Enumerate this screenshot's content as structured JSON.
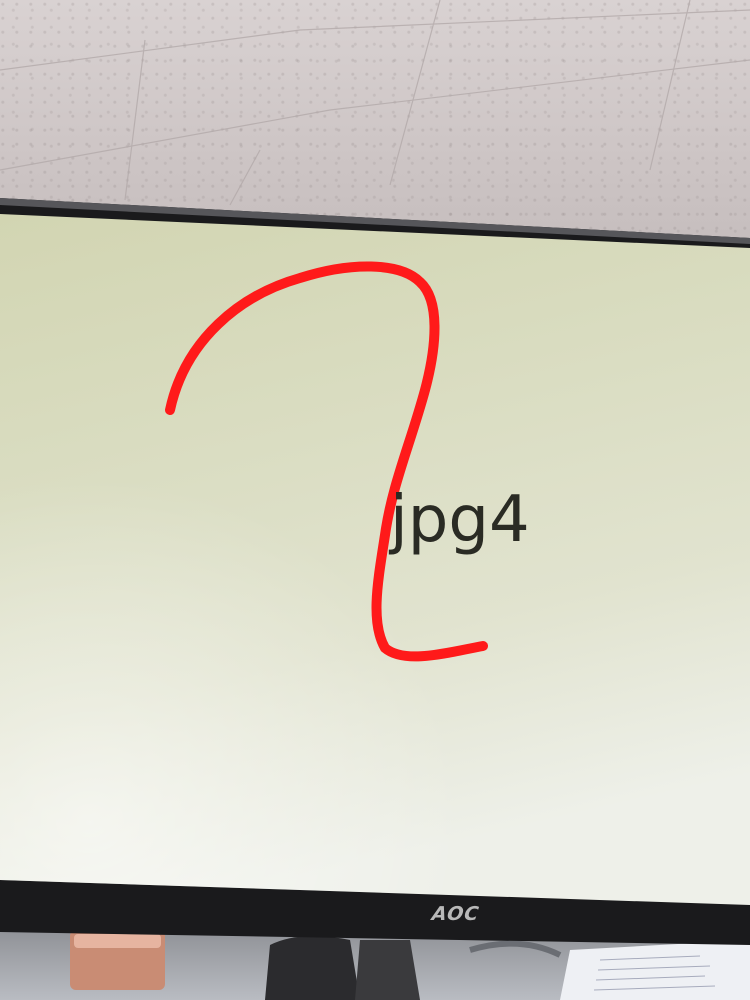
{
  "screen": {
    "text": "jpg4",
    "background_color": "#d9dcc0",
    "text_color": "#2a2b24"
  },
  "annotation": {
    "stroke_color": "#ff1a1a",
    "icon": "red-freehand-curve"
  },
  "monitor": {
    "brand": "AOC",
    "bezel_color": "#1a1a1c"
  },
  "room": {
    "ceiling_color": "#d4cccc"
  }
}
